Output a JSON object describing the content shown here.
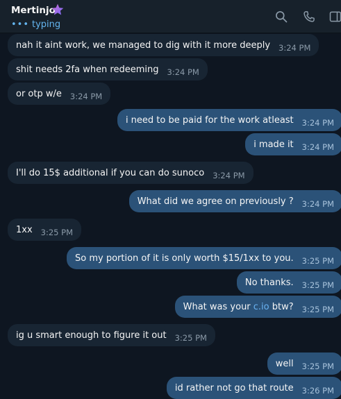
{
  "header": {
    "contact_name": "Mertinjo",
    "status_text": "typing",
    "status_dots": "•••",
    "icons": [
      "search-icon",
      "phone-icon",
      "side-panel-icon"
    ],
    "accent_color": "#64b5ef"
  },
  "messages": [
    {
      "text": "nah it aint work, we managed to dig with it more deeply",
      "time": "3:24 PM",
      "direction": "incoming"
    },
    {
      "text": "shit needs 2fa when redeeming",
      "time": "3:24 PM",
      "direction": "incoming"
    },
    {
      "text": "or otp w/e",
      "time": "3:24 PM",
      "direction": "incoming"
    },
    {
      "text": "i need to be paid for the work atleast",
      "time": "3:24 PM",
      "direction": "outgoing"
    },
    {
      "text": "i made it",
      "time": "3:24 PM",
      "direction": "outgoing"
    },
    {
      "text": "I'll do 15$ additional if you can do sunoco",
      "time": "3:24 PM",
      "direction": "incoming"
    },
    {
      "text": "What did we agree on previously ?",
      "time": "3:24 PM",
      "direction": "outgoing"
    },
    {
      "text": "1xx",
      "time": "3:25 PM",
      "direction": "incoming"
    },
    {
      "text": "So my portion of it is only worth $15/1xx to you.",
      "time": "3:25 PM",
      "direction": "outgoing"
    },
    {
      "text": "No thanks.",
      "time": "3:25 PM",
      "direction": "outgoing"
    },
    {
      "text_before": "What was your ",
      "link_text": "c.io",
      "text_after": " btw?",
      "time": "3:25 PM",
      "direction": "outgoing"
    },
    {
      "text": "ig u smart enough to figure it out",
      "time": "3:25 PM",
      "direction": "incoming"
    },
    {
      "text": "well",
      "time": "3:25 PM",
      "direction": "outgoing"
    },
    {
      "text": "id rather not go that route",
      "time": "3:26 PM",
      "direction": "outgoing"
    }
  ],
  "colors": {
    "background": "#0e1621",
    "header": "#17212b",
    "incoming_bubble": "#182533",
    "outgoing_bubble": "#2b5278",
    "link": "#6ab3f3"
  }
}
